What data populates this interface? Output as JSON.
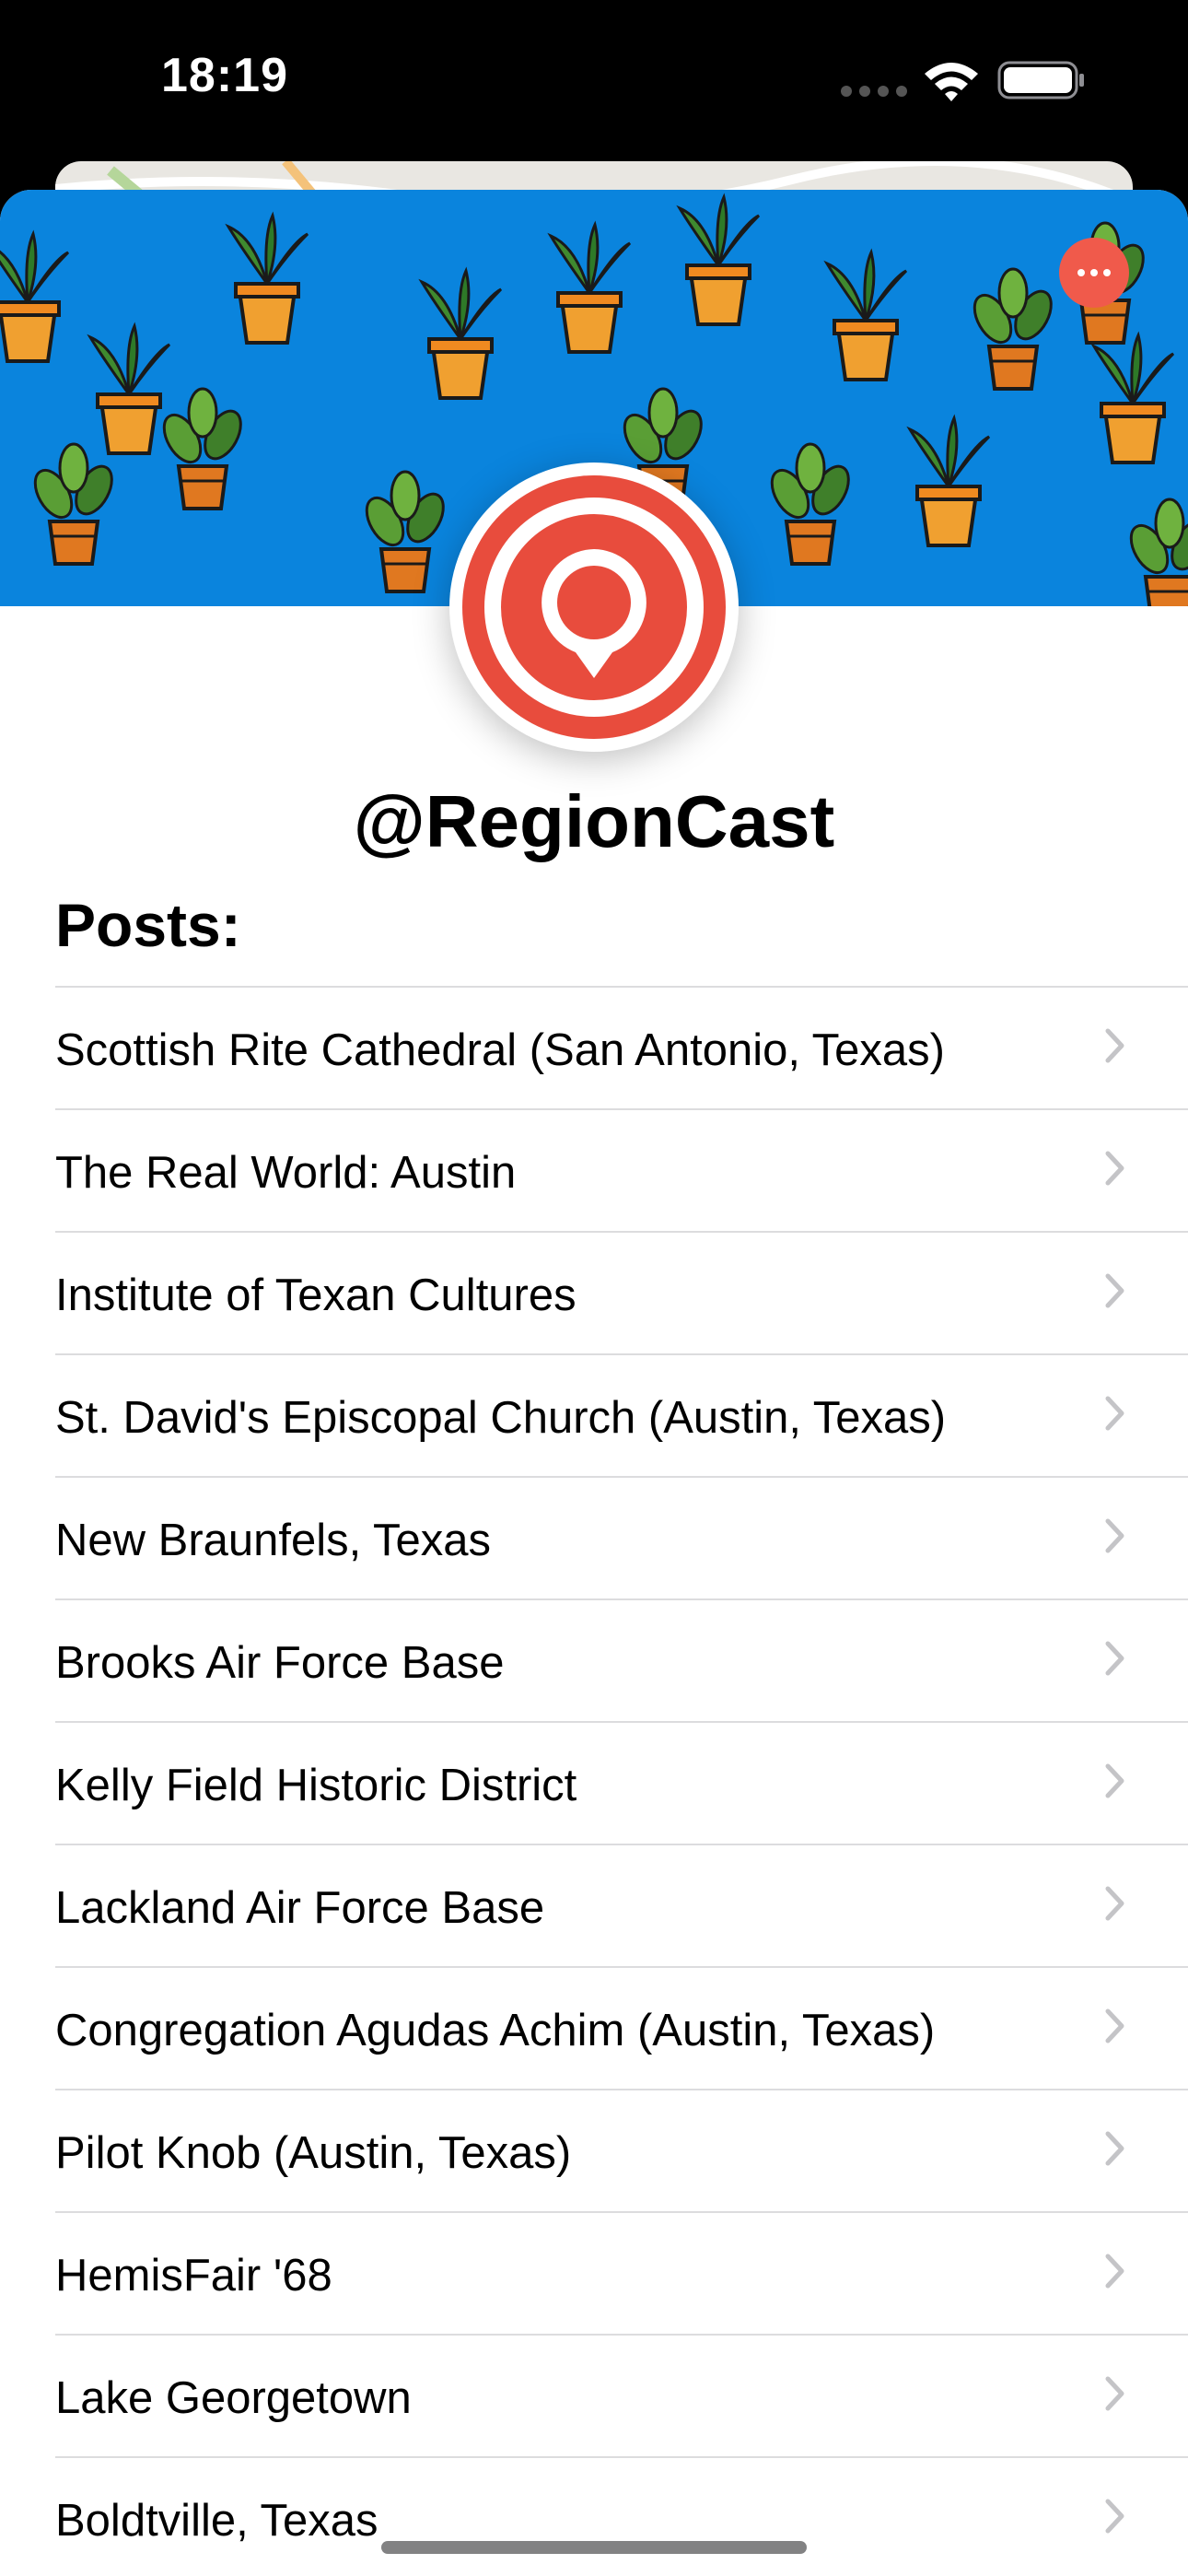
{
  "status_bar": {
    "time": "18:19",
    "wifi_icon": "wifi-icon",
    "battery_icon": "battery-icon"
  },
  "profile": {
    "username": "@RegionCast",
    "avatar_icon": "location-pin-icon",
    "accent_color": "#e84c3d",
    "banner_color": "#0a84dd",
    "banner_pattern": "potted-plants"
  },
  "more_button_icon": "ellipsis-icon",
  "posts": {
    "heading": "Posts:",
    "items": [
      {
        "label": "Scottish Rite Cathedral (San Antonio, Texas)"
      },
      {
        "label": "The Real World: Austin"
      },
      {
        "label": "Institute of Texan Cultures"
      },
      {
        "label": "St. David's Episcopal Church (Austin, Texas)"
      },
      {
        "label": "New Braunfels, Texas"
      },
      {
        "label": "Brooks Air Force Base"
      },
      {
        "label": "Kelly Field Historic District"
      },
      {
        "label": "Lackland Air Force Base"
      },
      {
        "label": "Congregation Agudas Achim (Austin, Texas)"
      },
      {
        "label": "Pilot Knob (Austin, Texas)"
      },
      {
        "label": "HemisFair '68"
      },
      {
        "label": "Lake Georgetown"
      },
      {
        "label": "Boldtville, Texas"
      }
    ]
  }
}
